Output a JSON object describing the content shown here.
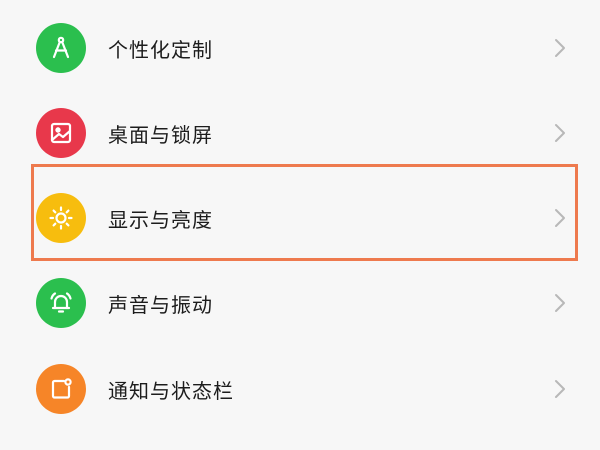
{
  "settings": {
    "items": [
      {
        "label": "个性化定制",
        "icon": "compass-icon",
        "color": "#2bbf4e"
      },
      {
        "label": "桌面与锁屏",
        "icon": "wallpaper-icon",
        "color": "#e8384b"
      },
      {
        "label": "显示与亮度",
        "icon": "brightness-icon",
        "color": "#f7bd0e"
      },
      {
        "label": "声音与振动",
        "icon": "bell-icon",
        "color": "#2bbf4e"
      },
      {
        "label": "通知与状态栏",
        "icon": "notification-icon",
        "color": "#f68528"
      }
    ],
    "highlighted_item": "显示与亮度",
    "highlight_color": "#ee7a4e",
    "chevron_color": "#b8b8b8"
  }
}
